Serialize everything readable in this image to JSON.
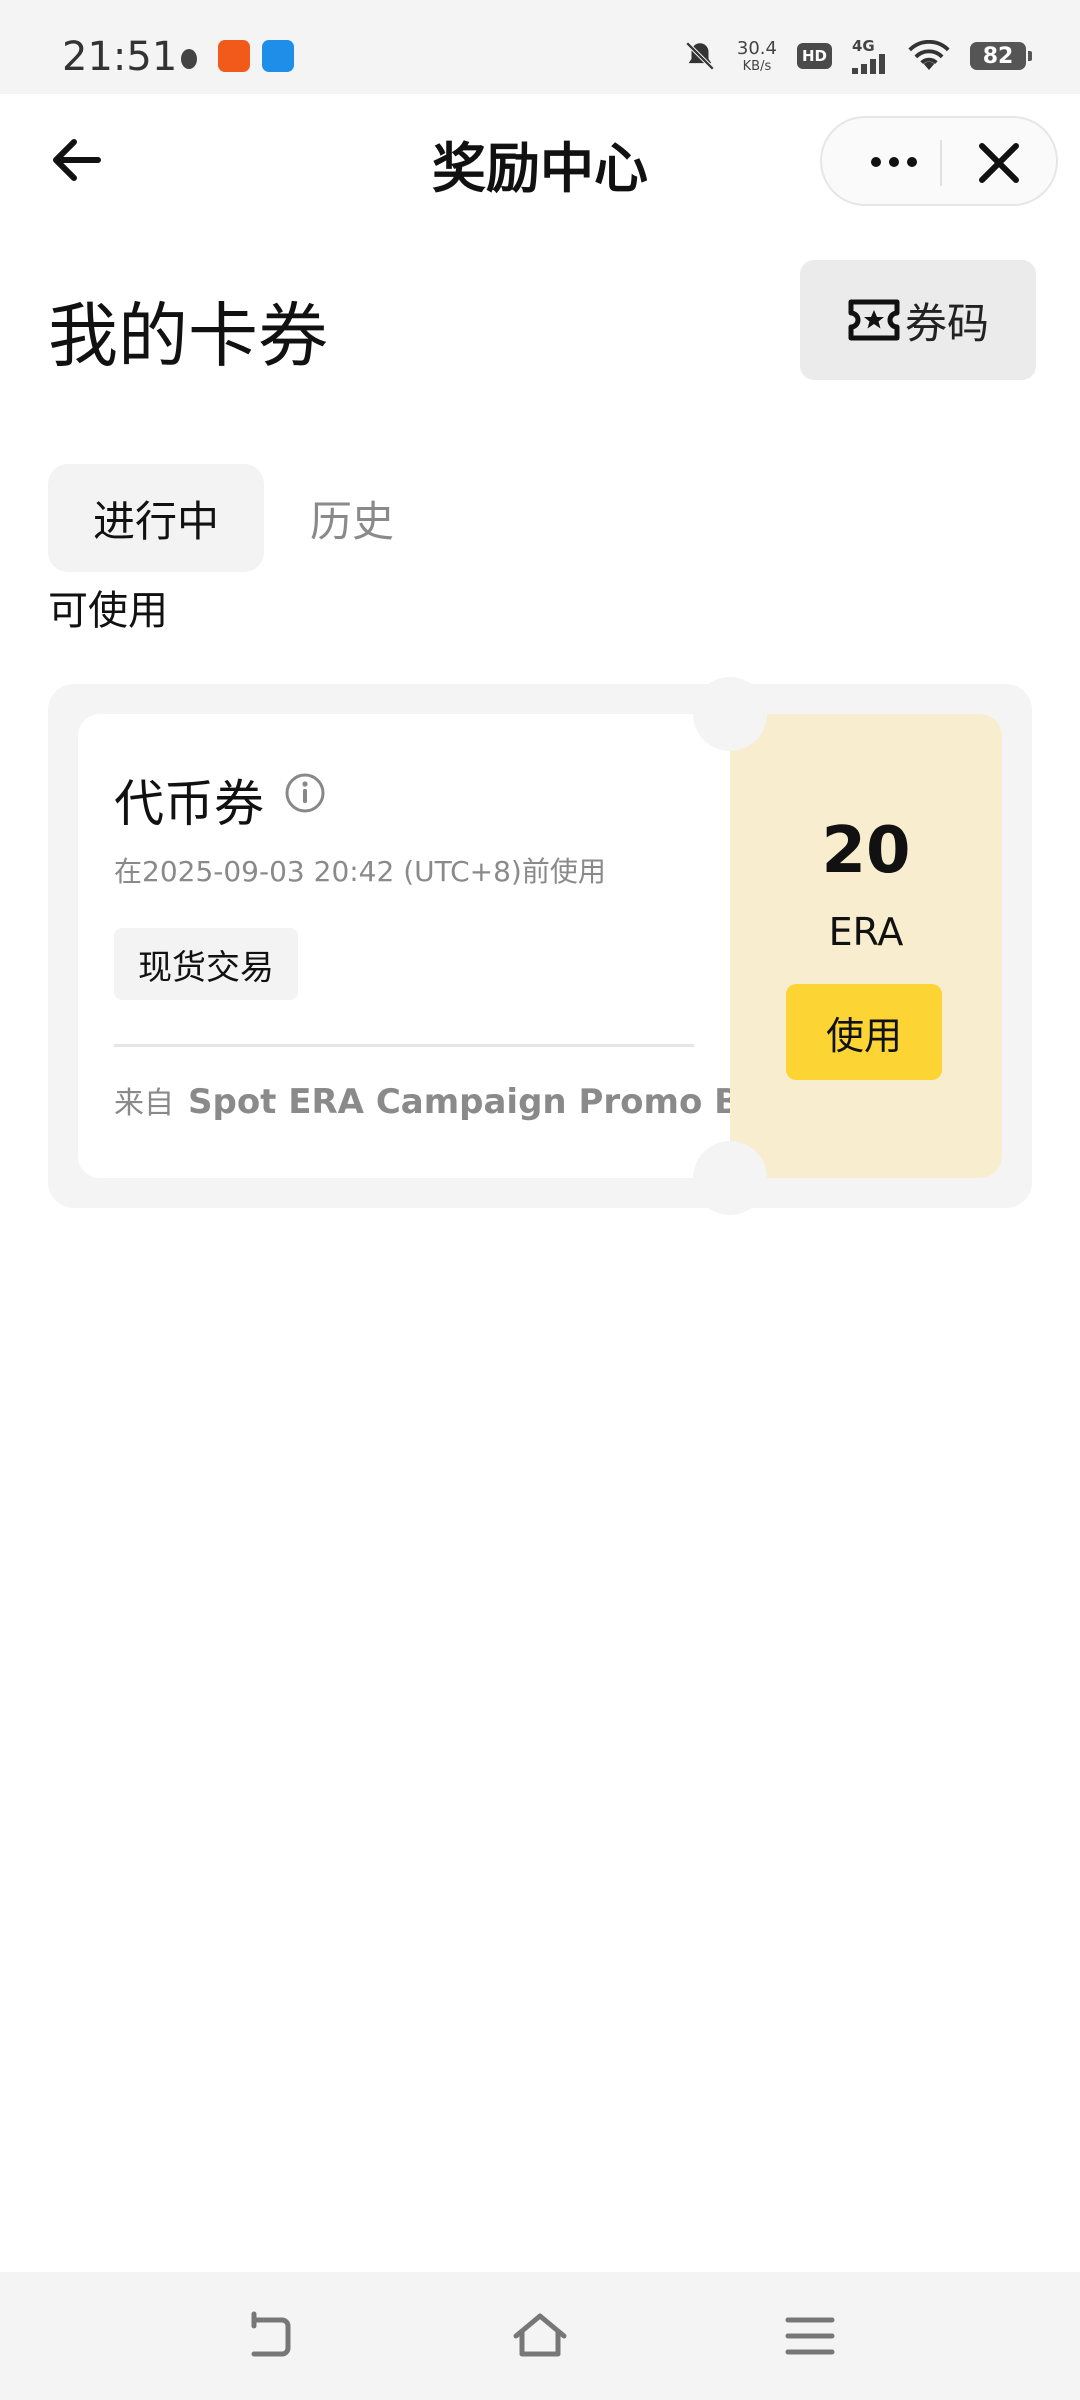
{
  "status_bar": {
    "time": "21:51",
    "net_speed_value": "30.4",
    "net_speed_unit": "KB/s",
    "hd": "HD",
    "network": "4G",
    "battery": "82"
  },
  "header": {
    "title": "奖励中心"
  },
  "page": {
    "title": "我的卡券",
    "code_button_label": "券码"
  },
  "tabs": [
    {
      "label": "进行中",
      "active": true
    },
    {
      "label": "历史",
      "active": false
    }
  ],
  "section_label": "可使用",
  "coupon": {
    "name": "代币券",
    "expiry": "在2025-09-03 20:42 (UTC+8)前使用",
    "tag": "现货交易",
    "source_prefix": "来自",
    "source_name": "Spot ERA Campaign Promo B",
    "amount": "20",
    "unit": "ERA",
    "use_label": "使用"
  },
  "colors": {
    "accent": "#fcd535",
    "coupon_right_bg": "#f8eecf",
    "card_bg": "#f4f4f4"
  }
}
